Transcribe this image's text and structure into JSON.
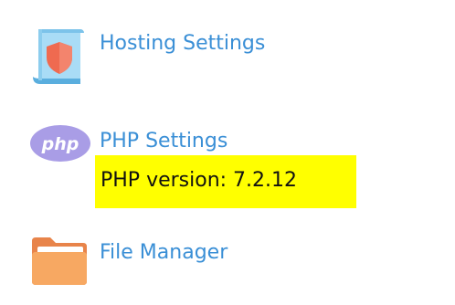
{
  "items": [
    {
      "label": "Hosting Settings",
      "icon": "shield-document-icon"
    },
    {
      "label": "PHP Settings",
      "icon": "php-icon",
      "icon_text": "php"
    },
    {
      "label": "File Manager",
      "icon": "folder-icon"
    }
  ],
  "php_version_note": "PHP version: 7.2.12",
  "colors": {
    "link": "#3a8fd6",
    "highlight": "#ffff00",
    "php_badge": "#a99de6",
    "folder": "#f5a05a",
    "shield": "#ef6a50"
  }
}
